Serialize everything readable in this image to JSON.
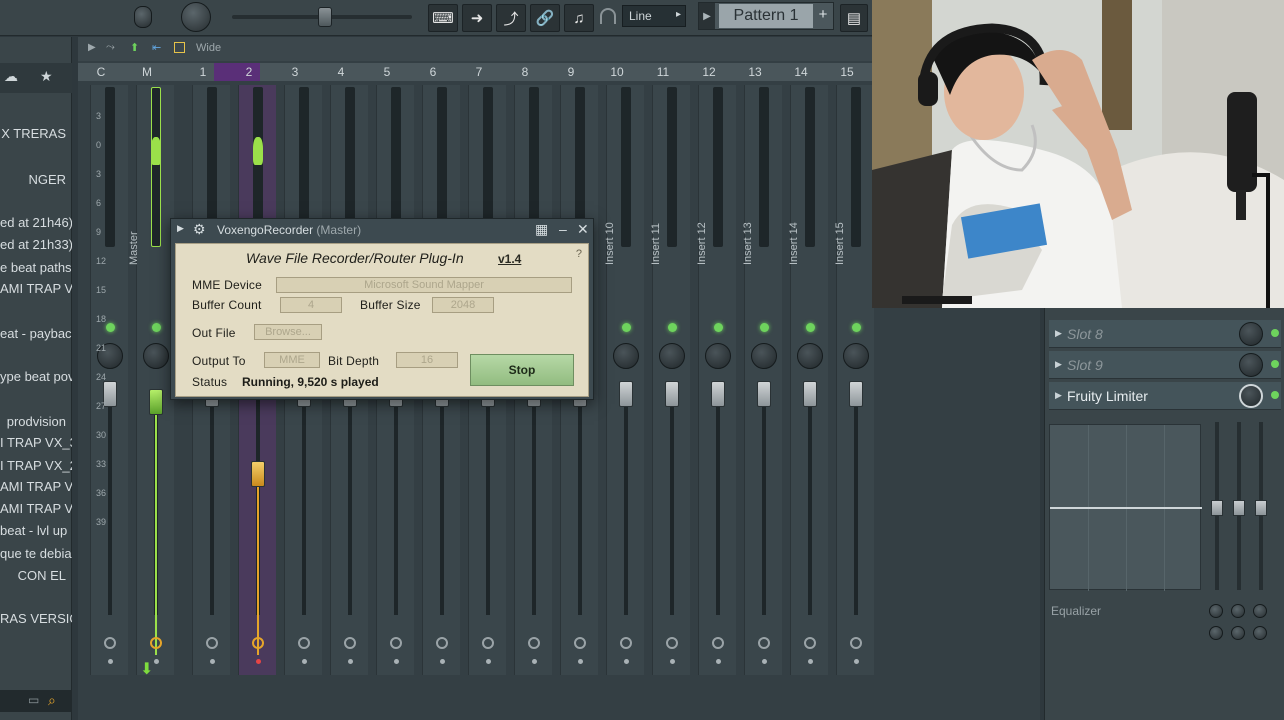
{
  "toolbar": {
    "snap_mode": "Line",
    "pattern_name": "Pattern 1",
    "pattern_add": "+"
  },
  "browser": {
    "items": [
      "X TRERAS",
      "NGER",
      "ed at 21h46)",
      "ed at 21h33)",
      "e beat paths",
      "AMI TRAP VX",
      "eat - payback",
      "ype beat pov",
      "prodvision",
      "I TRAP VX_3",
      "I TRAP VX_2",
      "AMI TRAP VX",
      "AMI TRAP VX",
      " beat - lvl up",
      "que te debia",
      " CON EL",
      "RAS VERSION"
    ]
  },
  "mixer": {
    "tools_label": "Wide",
    "track_headers": [
      "C",
      "M",
      "1",
      "2",
      "3",
      "4",
      "5",
      "6",
      "7",
      "8",
      "9",
      "10",
      "11",
      "12",
      "13",
      "14",
      "15"
    ],
    "master_label": "Master",
    "insert_labels": [
      "Insert 10",
      "Insert 11",
      "Insert 12",
      "Insert 13",
      "Insert 14",
      "Insert 15"
    ],
    "db_scale": [
      "3",
      "0",
      "3",
      "6",
      "9",
      "12",
      "15",
      "18",
      "21",
      "24",
      "27",
      "30",
      "33",
      "36",
      "39"
    ]
  },
  "plugin": {
    "window_title": "VoxengoRecorder",
    "window_title_suffix": "(Master)",
    "heading": "Wave File Recorder/Router Plug-In",
    "version": "v1.4",
    "help": "?",
    "mme_device_label": "MME Device",
    "mme_device_value": "Microsoft Sound Mapper",
    "buffer_count_label": "Buffer Count",
    "buffer_count_value": "4",
    "buffer_size_label": "Buffer Size",
    "buffer_size_value": "2048",
    "out_file_label": "Out File",
    "browse_label": "Browse...",
    "output_to_label": "Output To",
    "output_to_value": "MME",
    "bit_depth_label": "Bit Depth",
    "bit_depth_value": "16",
    "status_label": "Status",
    "status_value": "Running, 9,520 s played",
    "stop_label": "Stop"
  },
  "fx_panel": {
    "slots": [
      {
        "label": "Slot 8",
        "active": false
      },
      {
        "label": "Slot 9",
        "active": false
      },
      {
        "label": "Fruity Limiter",
        "active": true
      }
    ],
    "eq_label": "Equalizer"
  },
  "colors": {
    "accent_green": "#6ed35d",
    "selected_track": "#4a3a5c",
    "master_meter": "#9be04a",
    "fader_orange": "#e6a52a"
  }
}
